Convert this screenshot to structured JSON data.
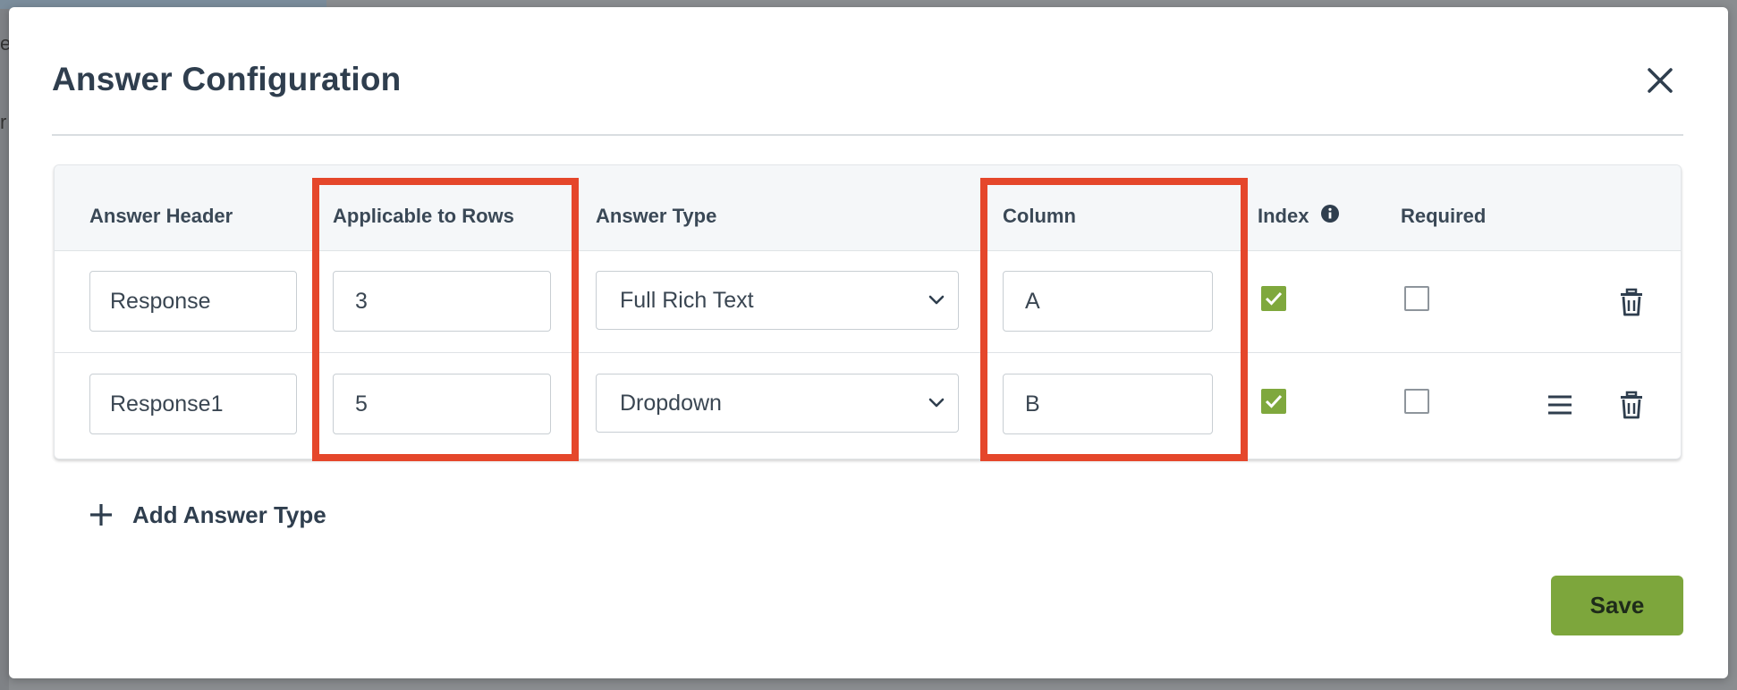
{
  "background": {
    "left_letter_1": "e",
    "left_letter_2": "r"
  },
  "modal": {
    "title": "Answer Configuration",
    "close_icon": "close-icon"
  },
  "table": {
    "headers": {
      "answer_header": "Answer Header",
      "applicable_rows": "Applicable to Rows",
      "answer_type": "Answer Type",
      "column": "Column",
      "index": "Index",
      "required": "Required"
    },
    "rows": [
      {
        "answer_header": "Response",
        "applicable_rows": "3",
        "answer_type": "Full Rich Text",
        "column": "A",
        "index_checked": true,
        "required_checked": false,
        "has_drag_handle": false
      },
      {
        "answer_header": "Response1",
        "applicable_rows": "5",
        "answer_type": "Dropdown",
        "column": "B",
        "index_checked": true,
        "required_checked": false,
        "has_drag_handle": true
      }
    ]
  },
  "actions": {
    "add_answer_type": "Add Answer Type",
    "save": "Save"
  },
  "colors": {
    "accent_green": "#7da63c",
    "highlight_red": "#e5472b",
    "title_text": "#2f3e4e"
  }
}
